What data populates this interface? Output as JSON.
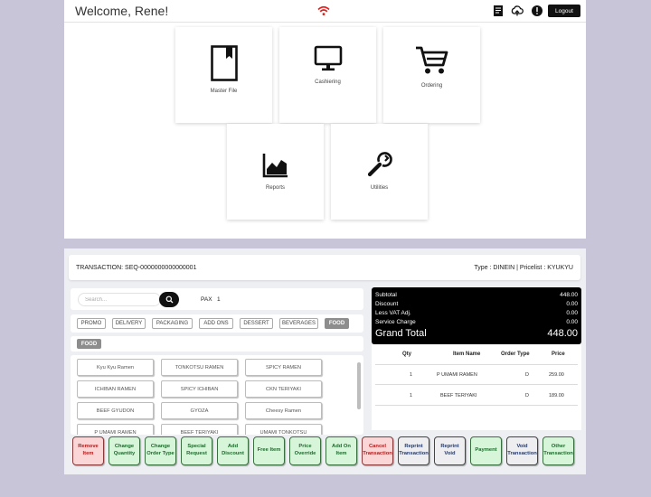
{
  "header": {
    "welcome": "Welcome, Rene!",
    "logout_label": "Logout",
    "icons": [
      "wifi-icon",
      "receipt-icon",
      "cloud-sync-icon",
      "warning-icon"
    ]
  },
  "menu": [
    {
      "label": "Master File",
      "icon": "bookmark-icon"
    },
    {
      "label": "Cashiering",
      "icon": "monitor-icon"
    },
    {
      "label": "Ordering",
      "icon": "cart-icon"
    },
    {
      "label": "Reports",
      "icon": "chart-icon"
    },
    {
      "label": "Utilities",
      "icon": "wrench-icon"
    }
  ],
  "transaction": {
    "label": "TRANSACTION: SEQ-0000000000000001",
    "type_label": "Type : DINEIN | Pricelist : KYUKYU"
  },
  "search": {
    "placeholder": "Search...",
    "pax_label": "PAX",
    "pax_value": "1"
  },
  "categories": [
    {
      "label": "PROMO",
      "active": false
    },
    {
      "label": "DELIVERY",
      "active": false
    },
    {
      "label": "PACKAGING",
      "active": false
    },
    {
      "label": "ADD ONS",
      "active": false
    },
    {
      "label": "DESSERT",
      "active": false
    },
    {
      "label": "BEVERAGES",
      "active": false
    },
    {
      "label": "FOOD",
      "active": true
    }
  ],
  "subcategory": "FOOD",
  "items": [
    "Kyu Kyu Ramen",
    "TONKOTSU RAMEN",
    "SPICY RAMEN",
    "ICHIBAN RAMEN",
    "SPICY ICHIBAN",
    "CKN TERIYAKI",
    "BEEF GYUDON",
    "GYOZA",
    "Cheesy Ramen",
    "P UMAMI RAMEN",
    "BEEF TERIYAKI",
    "UMAMI TONKOTSU"
  ],
  "totals": {
    "subtotal_label": "Subtotal",
    "subtotal": "448.00",
    "discount_label": "Discount",
    "discount": "0.00",
    "vat_label": "Less VAT Adj.",
    "vat": "0.00",
    "service_label": "Service Charge",
    "service": "0.00",
    "grand_label": "Grand Total",
    "grand": "448.00"
  },
  "order": {
    "headers": {
      "qty": "Qty",
      "item": "Item Name",
      "type": "Order Type",
      "price": "Price"
    },
    "rows": [
      {
        "qty": "1",
        "item": "P UMAMI RAMEN",
        "type": "D",
        "price": "259.00"
      },
      {
        "qty": "1",
        "item": "BEEF TERIYAKI",
        "type": "D",
        "price": "189.00"
      }
    ]
  },
  "actions": [
    {
      "label": "Remove\nItem",
      "style": "red"
    },
    {
      "label": "Change\nQuantity",
      "style": "green"
    },
    {
      "label": "Change\nOrder Type",
      "style": "green"
    },
    {
      "label": "Special\nRequest",
      "style": "green"
    },
    {
      "label": "Add\nDiscount",
      "style": "green"
    },
    {
      "label": "Free Item",
      "style": "green"
    },
    {
      "label": "Price\nOverride",
      "style": "green"
    },
    {
      "label": "Add On\nItem",
      "style": "green"
    },
    {
      "label": "Cancel\nTransaction",
      "style": "red"
    },
    {
      "label": "Reprint\nTransaction",
      "style": "grey"
    },
    {
      "label": "Reprint\nVoid",
      "style": "grey"
    },
    {
      "label": "Payment",
      "style": "green"
    },
    {
      "label": "Void\nTransaction",
      "style": "grey"
    },
    {
      "label": "Other\nTransaction",
      "style": "green"
    }
  ],
  "colors": {
    "accent_dark": "#000000",
    "action_green": "#d6f5d9",
    "action_red": "#fbd6d6",
    "wifi_red": "#e0201c"
  }
}
